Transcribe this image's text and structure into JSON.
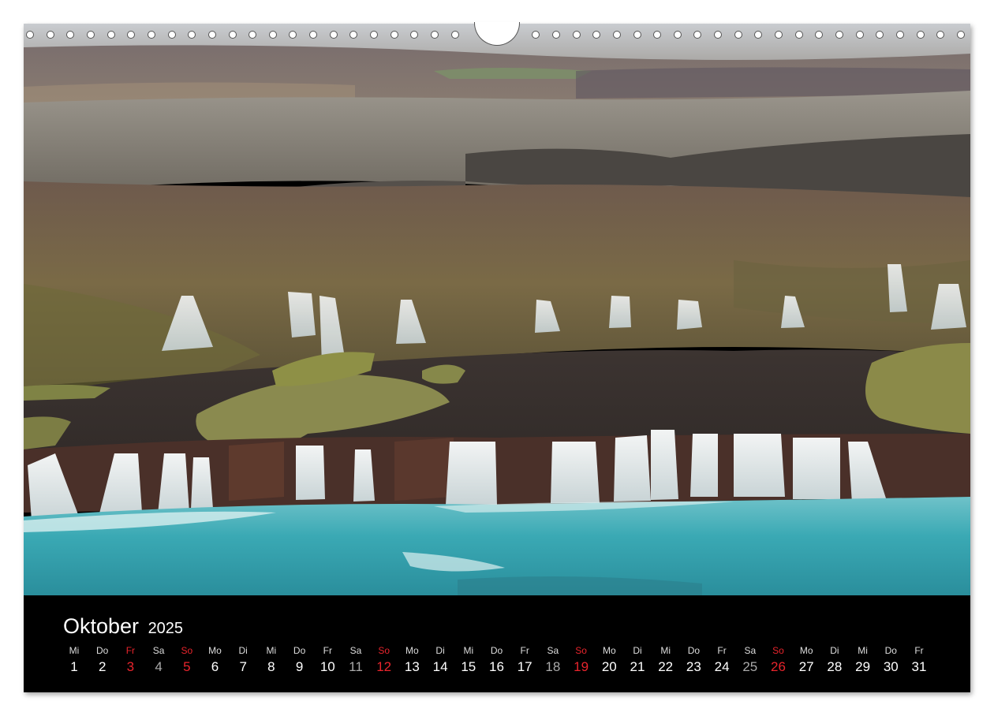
{
  "calendar": {
    "month": "Oktober",
    "year": "2025",
    "days": [
      {
        "wd": "Mi",
        "num": "1",
        "kind": "normal"
      },
      {
        "wd": "Do",
        "num": "2",
        "kind": "normal"
      },
      {
        "wd": "Fr",
        "num": "3",
        "kind": "red"
      },
      {
        "wd": "Sa",
        "num": "4",
        "kind": "sat"
      },
      {
        "wd": "So",
        "num": "5",
        "kind": "red"
      },
      {
        "wd": "Mo",
        "num": "6",
        "kind": "normal"
      },
      {
        "wd": "Di",
        "num": "7",
        "kind": "normal"
      },
      {
        "wd": "Mi",
        "num": "8",
        "kind": "normal"
      },
      {
        "wd": "Do",
        "num": "9",
        "kind": "normal"
      },
      {
        "wd": "Fr",
        "num": "10",
        "kind": "normal"
      },
      {
        "wd": "Sa",
        "num": "11",
        "kind": "sat"
      },
      {
        "wd": "So",
        "num": "12",
        "kind": "red"
      },
      {
        "wd": "Mo",
        "num": "13",
        "kind": "normal"
      },
      {
        "wd": "Di",
        "num": "14",
        "kind": "normal"
      },
      {
        "wd": "Mi",
        "num": "15",
        "kind": "normal"
      },
      {
        "wd": "Do",
        "num": "16",
        "kind": "normal"
      },
      {
        "wd": "Fr",
        "num": "17",
        "kind": "normal"
      },
      {
        "wd": "Sa",
        "num": "18",
        "kind": "sat"
      },
      {
        "wd": "So",
        "num": "19",
        "kind": "red"
      },
      {
        "wd": "Mo",
        "num": "20",
        "kind": "normal"
      },
      {
        "wd": "Di",
        "num": "21",
        "kind": "normal"
      },
      {
        "wd": "Mi",
        "num": "22",
        "kind": "normal"
      },
      {
        "wd": "Do",
        "num": "23",
        "kind": "normal"
      },
      {
        "wd": "Fr",
        "num": "24",
        "kind": "normal"
      },
      {
        "wd": "Sa",
        "num": "25",
        "kind": "sat"
      },
      {
        "wd": "So",
        "num": "26",
        "kind": "red"
      },
      {
        "wd": "Mo",
        "num": "27",
        "kind": "normal"
      },
      {
        "wd": "Di",
        "num": "28",
        "kind": "normal"
      },
      {
        "wd": "Mi",
        "num": "29",
        "kind": "normal"
      },
      {
        "wd": "Do",
        "num": "30",
        "kind": "normal"
      },
      {
        "wd": "Fr",
        "num": "31",
        "kind": "normal"
      }
    ]
  },
  "colors": {
    "holiday_red": "#e8242c",
    "calendar_bg": "#000000",
    "water": "#3aa9b4"
  }
}
